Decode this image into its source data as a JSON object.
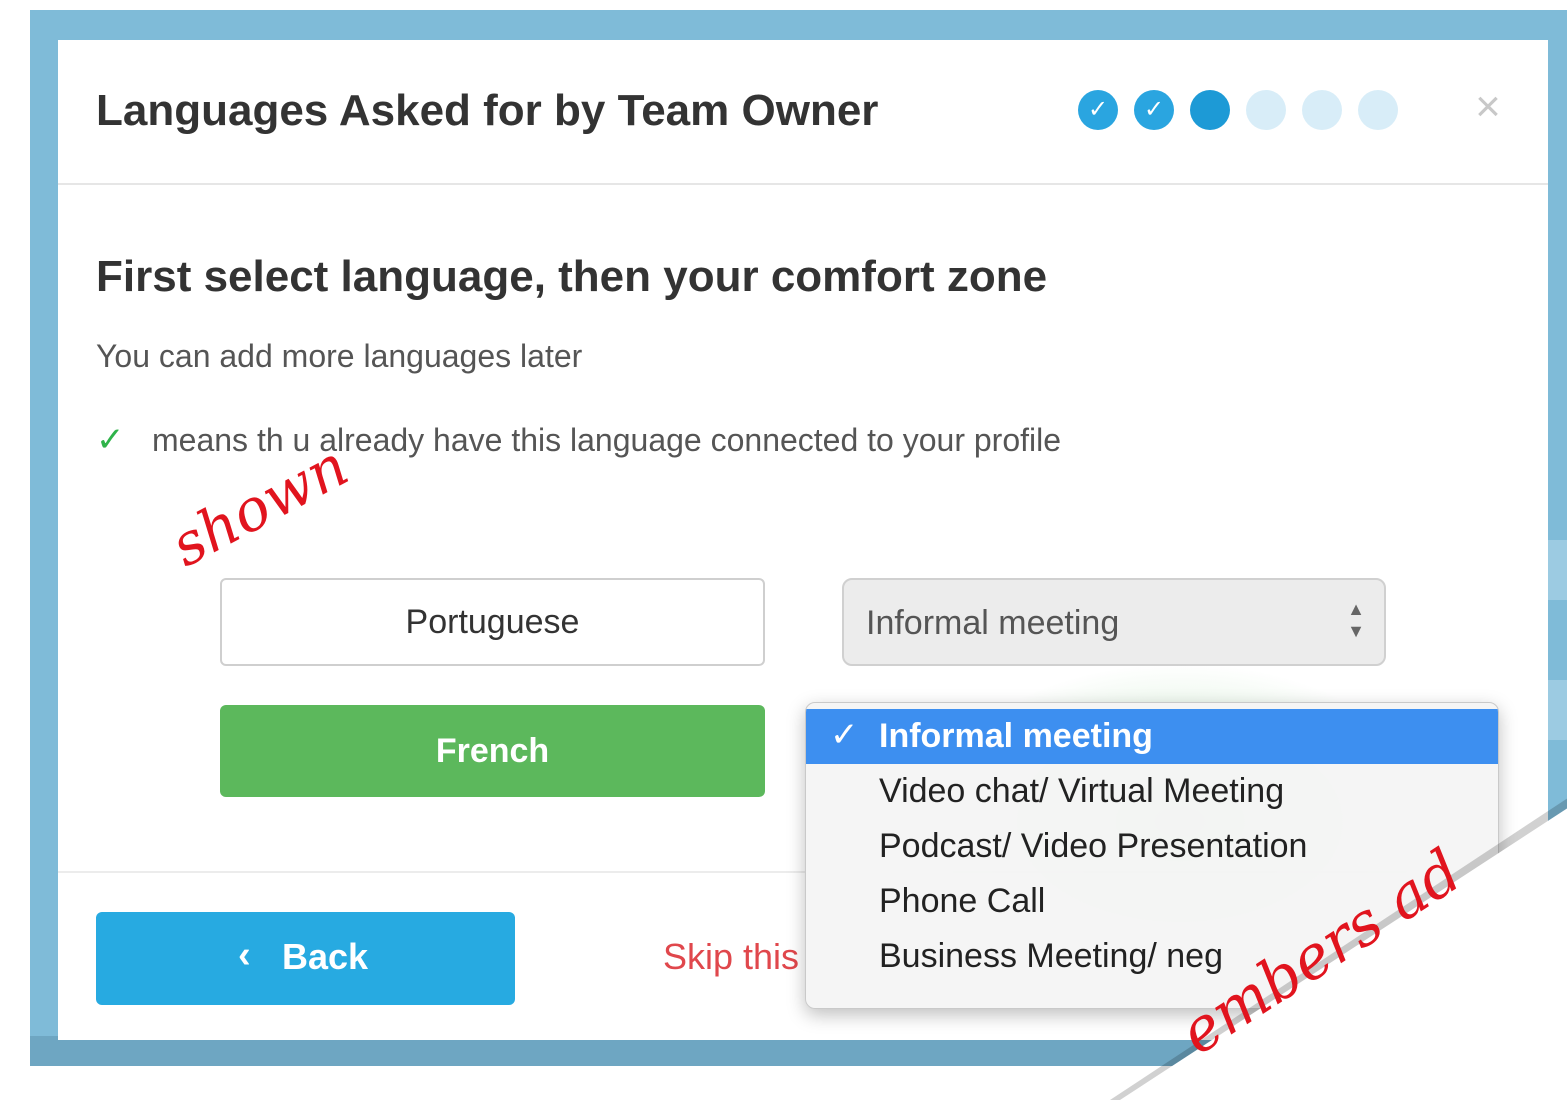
{
  "modal": {
    "title": "Languages Asked for by Team Owner",
    "close_glyph": "×",
    "steps": [
      {
        "state": "done",
        "glyph": "✓"
      },
      {
        "state": "done",
        "glyph": "✓"
      },
      {
        "state": "current",
        "glyph": ""
      },
      {
        "state": "todo",
        "glyph": ""
      },
      {
        "state": "todo",
        "glyph": ""
      },
      {
        "state": "todo",
        "glyph": ""
      }
    ]
  },
  "content": {
    "subtitle": "First select language, then your comfort zone",
    "hint": "You can add more languages later",
    "legend_icon": "check-icon",
    "legend_text": "means th    u already have this language connected to your profile"
  },
  "languages": [
    {
      "label": "Portuguese",
      "state": "unselected"
    },
    {
      "label": "French",
      "state": "selected"
    }
  ],
  "comfort_select": {
    "value": "Informal meeting",
    "arrows": "▲▼"
  },
  "dropdown": {
    "options": [
      {
        "label": "Informal meeting",
        "selected": true
      },
      {
        "label": "Video chat/ Virtual Meeting",
        "selected": false
      },
      {
        "label": "Podcast/ Video Presentation",
        "selected": false
      },
      {
        "label": "Phone Call",
        "selected": false
      },
      {
        "label": "Business Meeting/ neg",
        "selected": false
      }
    ],
    "check_glyph": "✓"
  },
  "footer": {
    "back_icon": "‹",
    "back_label": "Back",
    "skip_label": "Skip this"
  },
  "annotations": {
    "shown": "shown",
    "members": "embers ad"
  },
  "colors": {
    "accent_blue": "#27aae1",
    "selected_green": "#5cb85c",
    "skip_red": "#e0474c",
    "annotation_red": "#e1141e",
    "menu_highlight": "#3d8ff0"
  }
}
